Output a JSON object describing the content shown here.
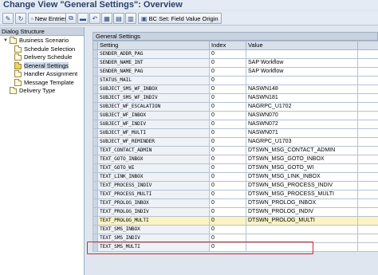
{
  "window": {
    "title": "Change View \"General Settings\": Overview"
  },
  "toolbar": {
    "new_entries_label": "New Entries",
    "bc_set_label": "BC Set: Field Value Origin",
    "icons": [
      "edit-icon",
      "new-entries-icon",
      "copy-icon",
      "delete-icon",
      "undo-icon",
      "select-all-icon",
      "deselect-icon",
      "bc-set-icon"
    ]
  },
  "left_panel": {
    "header": "Dialog Structure",
    "items": [
      {
        "label": "Business Scenario",
        "selected": false,
        "icon": "folder-icon"
      },
      {
        "label": "Schedule Selection",
        "selected": false,
        "icon": "folder-icon"
      },
      {
        "label": "Delivery Schedule",
        "selected": false,
        "icon": "folder-icon"
      },
      {
        "label": "General Settings",
        "selected": true,
        "icon": "folder-open-icon"
      },
      {
        "label": "Handler Assignment",
        "selected": false,
        "icon": "folder-icon"
      },
      {
        "label": "Message Template",
        "selected": false,
        "icon": "folder-icon"
      },
      {
        "label": "Delivery Type",
        "selected": false,
        "icon": "folder-icon"
      }
    ]
  },
  "table": {
    "title": "General Settings",
    "columns": [
      "Setting",
      "Index",
      "Value"
    ],
    "rows": [
      {
        "setting": "SENDER_ADDR_PAG",
        "index": "0",
        "value": ""
      },
      {
        "setting": "SENDER_NAME_INT",
        "index": "0",
        "value": "SAP Workflow"
      },
      {
        "setting": "SENDER_NAME_PAG",
        "index": "0",
        "value": "SAP Workflow"
      },
      {
        "setting": "STATUS_MAIL",
        "index": "0",
        "value": ""
      },
      {
        "setting": "SUBJECT_SMS_WF_INBOX",
        "index": "0",
        "value": "NASWN148"
      },
      {
        "setting": "SUBJECT_SMS_WF_INDIV",
        "index": "0",
        "value": "NASWN181"
      },
      {
        "setting": "SUBJECT_WF_ESCALATION",
        "index": "0",
        "value": "NAGRPC_U1702"
      },
      {
        "setting": "SUBJECT_WF_INBOX",
        "index": "0",
        "value": "NASWN070"
      },
      {
        "setting": "SUBJECT_WF_INDIV",
        "index": "0",
        "value": "NASWN072"
      },
      {
        "setting": "SUBJECT_WF_MULTI",
        "index": "0",
        "value": "NASWN071"
      },
      {
        "setting": "SUBJECT_WF_REMINDER",
        "index": "0",
        "value": "NAGRPC_U1703"
      },
      {
        "setting": "TEXT_CONTACT_ADMIN",
        "index": "0",
        "value": "DTSWN_MSG_CONTACT_ADMIN"
      },
      {
        "setting": "TEXT_GOTO_INBOX",
        "index": "0",
        "value": "DTSWN_MSG_GOTO_INBOX"
      },
      {
        "setting": "TEXT_GOTO_WI",
        "index": "0",
        "value": "DTSWN_MSG_GOTO_WI"
      },
      {
        "setting": "TEXT_LINK_INBOX",
        "index": "0",
        "value": "DTSWN_MSG_LINK_INBOX"
      },
      {
        "setting": "TEXT_PROCESS_INDIV",
        "index": "0",
        "value": "DTSWN_MSG_PROCESS_INDIV"
      },
      {
        "setting": "TEXT_PROCESS_MULTI",
        "index": "0",
        "value": "DTSWN_MSG_PROCESS_MULTI"
      },
      {
        "setting": "TEXT_PROLOG_INBOX",
        "index": "0",
        "value": "DTSWN_PROLOG_INBOX"
      },
      {
        "setting": "TEXT_PROLOG_INDIV",
        "index": "0",
        "value": "DTSWN_PROLOG_INDIV"
      },
      {
        "setting": "TEXT_PROLOG_MULTI",
        "index": "0",
        "value": "DTSWN_PROLOG_MULTI",
        "highlighted": true
      },
      {
        "setting": "TEXT_SMS_INBOX",
        "index": "0",
        "value": ""
      },
      {
        "setting": "TEXT_SMS_INDIV",
        "index": "0",
        "value": ""
      },
      {
        "setting": "TEXT_SMS_MULTI",
        "index": "0",
        "value": ""
      }
    ]
  },
  "colors": {
    "highlight_border": "#d9252a",
    "highlight_fill": "#fbf3c4",
    "title_text": "#2c3f6b"
  }
}
